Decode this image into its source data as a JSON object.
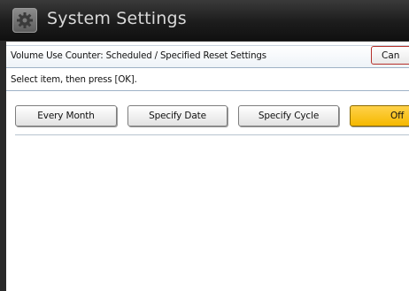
{
  "window": {
    "title": "System Settings"
  },
  "header": {
    "title": "Volume Use Counter: Scheduled / Specified Reset Settings",
    "cancel_label": "Can"
  },
  "instruction": "Select item, then press [OK].",
  "options": [
    {
      "label": "Every Month",
      "selected": false
    },
    {
      "label": "Specify Date",
      "selected": false
    },
    {
      "label": "Specify Cycle",
      "selected": false
    },
    {
      "label": "Off",
      "selected": true
    }
  ],
  "colors": {
    "title_bar": "#1c1c1c",
    "selected_option": "#f5b800",
    "cancel_border": "#b5312b"
  }
}
